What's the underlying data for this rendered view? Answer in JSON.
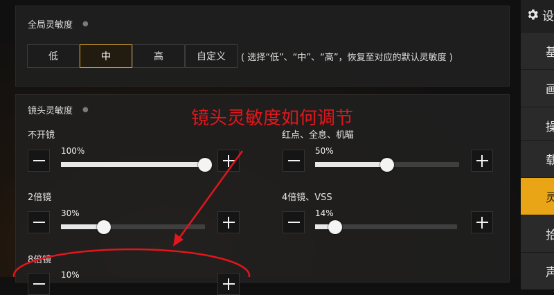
{
  "global": {
    "title": "全局灵敏度",
    "options": [
      "低",
      "中",
      "高",
      "自定义"
    ],
    "selected": "中",
    "hint": "( 选择“低”、“中”、“高”，恢复至对应的默认灵敏度 )"
  },
  "scope": {
    "title": "镜头灵敏度",
    "sliders": [
      {
        "label": "不开镜",
        "value": "100%",
        "level": 1.0
      },
      {
        "label": "红点、全息、机瞄",
        "value": "50%",
        "level": 0.5
      },
      {
        "label": "2倍镜",
        "value": "30%",
        "level": 0.3
      },
      {
        "label": "4倍镜、VSS",
        "value": "14%",
        "level": 0.14
      },
      {
        "label": "8倍镜",
        "value": "10%",
        "level": 0.1
      }
    ]
  },
  "annotation": {
    "text": "镜头灵敏度如何调节",
    "color": "#e2161c"
  },
  "sidebar": {
    "title": "设",
    "items": [
      "基",
      "画",
      "操",
      "载",
      "灵",
      "拾",
      "声"
    ],
    "active": "灵",
    "accent": "#e9a515"
  }
}
